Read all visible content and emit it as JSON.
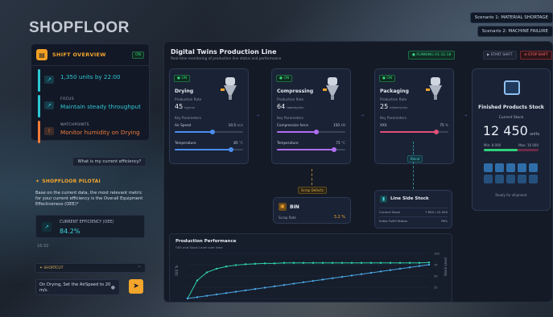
{
  "app": {
    "logo": "SHOPFLOOR"
  },
  "scenarios": [
    "Scenario 1: MATERIAL SHORTAGE",
    "Scenario 2: MACHINE FAILURE"
  ],
  "overview": {
    "title": "SHIFT OVERVIEW",
    "badge": "ON",
    "items": [
      {
        "key": "",
        "value": "1,350 units by 22:00",
        "color": "#2fc7d4",
        "icon": "chart-icon"
      },
      {
        "key": "FOCUS",
        "value": "Maintain steady throughput",
        "color": "#2fc7d4",
        "icon": "trend-icon"
      },
      {
        "key": "WATCHPOINTS",
        "value": "Monitor humidity on Drying",
        "color": "#f07b3a",
        "icon": "warning-icon"
      }
    ]
  },
  "chat": {
    "question": "What is my current efficiency?",
    "pilot_title": "SHOPFLOOR PILOTAI",
    "answer": "Base on the current data, the most relevant metric for your current efficiency is the Overall Equipment Effectiveness (OEE)*",
    "metric_label": "CURRENT EFFICIENCY (OEE)",
    "metric_value": "84.2%",
    "time": "16:32",
    "shortcut": "SHORTCUT",
    "input_value": "On Drying, Set the AirSpeed to 20 m/s."
  },
  "main": {
    "title": "Digital Twins Production Line",
    "subtitle": "Real-time monitoring of production line status and performance",
    "running": "● RUNNING  01:32:18",
    "start": "▶ START SHIFT",
    "stop": "⊘ STOP SHIFT"
  },
  "stations": [
    {
      "badge": "● ON",
      "name": "Drying",
      "rate_label": "Production Rate",
      "rate": "45",
      "rate_unit": "kg/min",
      "kp_label": "Key Parameters",
      "params": [
        {
          "label": "Air Speed",
          "value": "10.5",
          "unit": "m/s",
          "pct": 0.55,
          "color": "#4a8ef0"
        },
        {
          "label": "Temperature",
          "value": "85",
          "unit": "°C",
          "pct": 0.82,
          "color": "#4a8ef0"
        }
      ]
    },
    {
      "badge": "● ON",
      "name": "Compressing",
      "rate_label": "Production Rate",
      "rate": "64",
      "rate_unit": "tablets/min",
      "kp_label": "Key Parameters",
      "params": [
        {
          "label": "Compression force",
          "value": "150",
          "unit": "kN",
          "pct": 0.58,
          "color": "#b06ef0"
        },
        {
          "label": "Temperature",
          "value": "75",
          "unit": "°C",
          "pct": 0.84,
          "color": "#b06ef0"
        }
      ]
    },
    {
      "badge": "● ON",
      "name": "Packaging",
      "rate_label": "Production Rate",
      "rate": "25",
      "rate_unit": "blisters/min",
      "kp_label": "Key Parameters",
      "params": [
        {
          "label": "XXX",
          "value": "75",
          "unit": "%",
          "pct": 0.82,
          "color": "#e0507a"
        }
      ]
    }
  ],
  "finished": {
    "title": "Finished Products Stock",
    "label": "Current Stock",
    "value": "12 450",
    "unit": "units",
    "min": "Min: 8 000",
    "max": "Max: 16 000",
    "fill": 0.62,
    "ready": "Ready for shipment"
  },
  "bin": {
    "title": "BIN",
    "key": "Scrap Rate",
    "value": "3.2 %",
    "scrap_tag": "Scrap Defects"
  },
  "line_side": {
    "title": "Line Side Stock",
    "blend_tag": "Blend",
    "rows": [
      {
        "k": "Current Stock",
        "v": "7 850 / 10 000"
      },
      {
        "k": "Initial Fulfill Status",
        "v": "78%"
      }
    ]
  },
  "perf": {
    "title": "Production Performance",
    "subtitle": "OEE and Stock Level over time",
    "y_left": "OEE %",
    "y_right": "Stock Level",
    "right_ticks": [
      "100",
      "75",
      "50",
      "25"
    ]
  },
  "chart_data": {
    "type": "line",
    "xlabel": "",
    "ylabel": "OEE %",
    "series": [
      {
        "name": "OEE %",
        "values": [
          0,
          40,
          58,
          66,
          71,
          74,
          76,
          77,
          78,
          78,
          79,
          79,
          79,
          79,
          79,
          79,
          79,
          79,
          79,
          79,
          79,
          79,
          79,
          79,
          79,
          80
        ],
        "color": "#2ed1a8"
      },
      {
        "name": "Stock Level",
        "values": [
          0,
          3,
          6,
          9,
          12,
          15,
          18,
          21,
          24,
          27,
          30,
          33,
          36,
          39,
          42,
          45,
          48,
          51,
          54,
          57,
          60,
          63,
          66,
          69,
          72,
          75
        ],
        "color": "#4aa8e6"
      }
    ],
    "ylim": [
      0,
      100
    ]
  }
}
